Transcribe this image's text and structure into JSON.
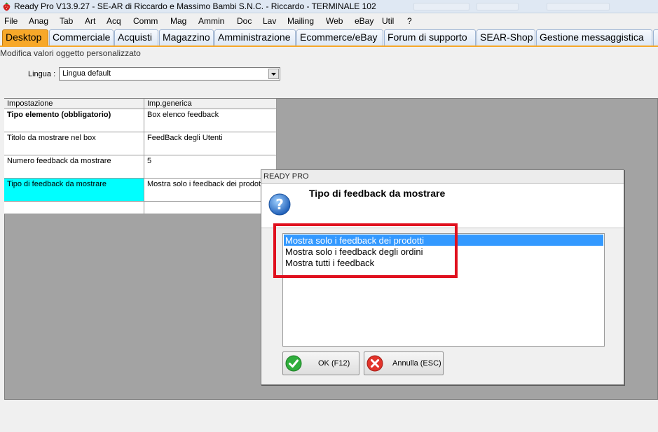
{
  "window": {
    "title": "Ready Pro V13.9.27 - SE-AR di Riccardo e Massimo Bambi S.N.C. - Riccardo - TERMINALE 102"
  },
  "menu": [
    "File",
    "Anag",
    "Tab",
    "Art",
    "Acq",
    "Comm",
    "Mag",
    "Ammin",
    "Doc",
    "Lav",
    "Mailing",
    "Web",
    "eBay",
    "Util",
    "?"
  ],
  "tabs": [
    "Desktop",
    "Commerciale",
    "Acquisti",
    "Magazzino",
    "Amministrazione",
    "Ecommerce/eBay",
    "Forum di supporto",
    "SEAR-Shop",
    "Gestione messaggistica"
  ],
  "active_tab": "Desktop",
  "page": {
    "caption": "Modifica valori oggetto personalizzato",
    "lingua_label": "Lingua :",
    "lingua_value": "Lingua default"
  },
  "grid": {
    "headers": [
      "Impostazione",
      "Imp.generica"
    ],
    "rows": [
      [
        "Tipo elemento (obbligatorio)",
        "Box elenco feedback"
      ],
      [
        "Titolo da mostrare nel box",
        "FeedBack degli Utenti"
      ],
      [
        "Numero feedback da mostrare",
        "5"
      ],
      [
        "Tipo di feedback da mostrare",
        "Mostra solo i feedback dei prodotti"
      ],
      [
        "",
        ""
      ]
    ]
  },
  "dialog": {
    "title": "READY PRO",
    "heading": "Tipo di feedback da mostrare",
    "options": [
      "Mostra solo i feedback dei prodotti",
      "Mostra solo i feedback degli ordini",
      "Mostra tutti i feedback"
    ],
    "selected_index": 0,
    "ok_label": "OK (F12)",
    "cancel_label": "Annulla (ESC)"
  },
  "colors": {
    "active_tab": "#f7a829",
    "highlight_cell": "#00ffff",
    "selection": "#3399ff",
    "annotation_box": "#e0101e"
  },
  "icons": {
    "app": "strawberry-icon",
    "question": "question-icon",
    "ok": "check-icon",
    "cancel": "cancel-icon",
    "dropdown": "chevron-down-icon"
  }
}
